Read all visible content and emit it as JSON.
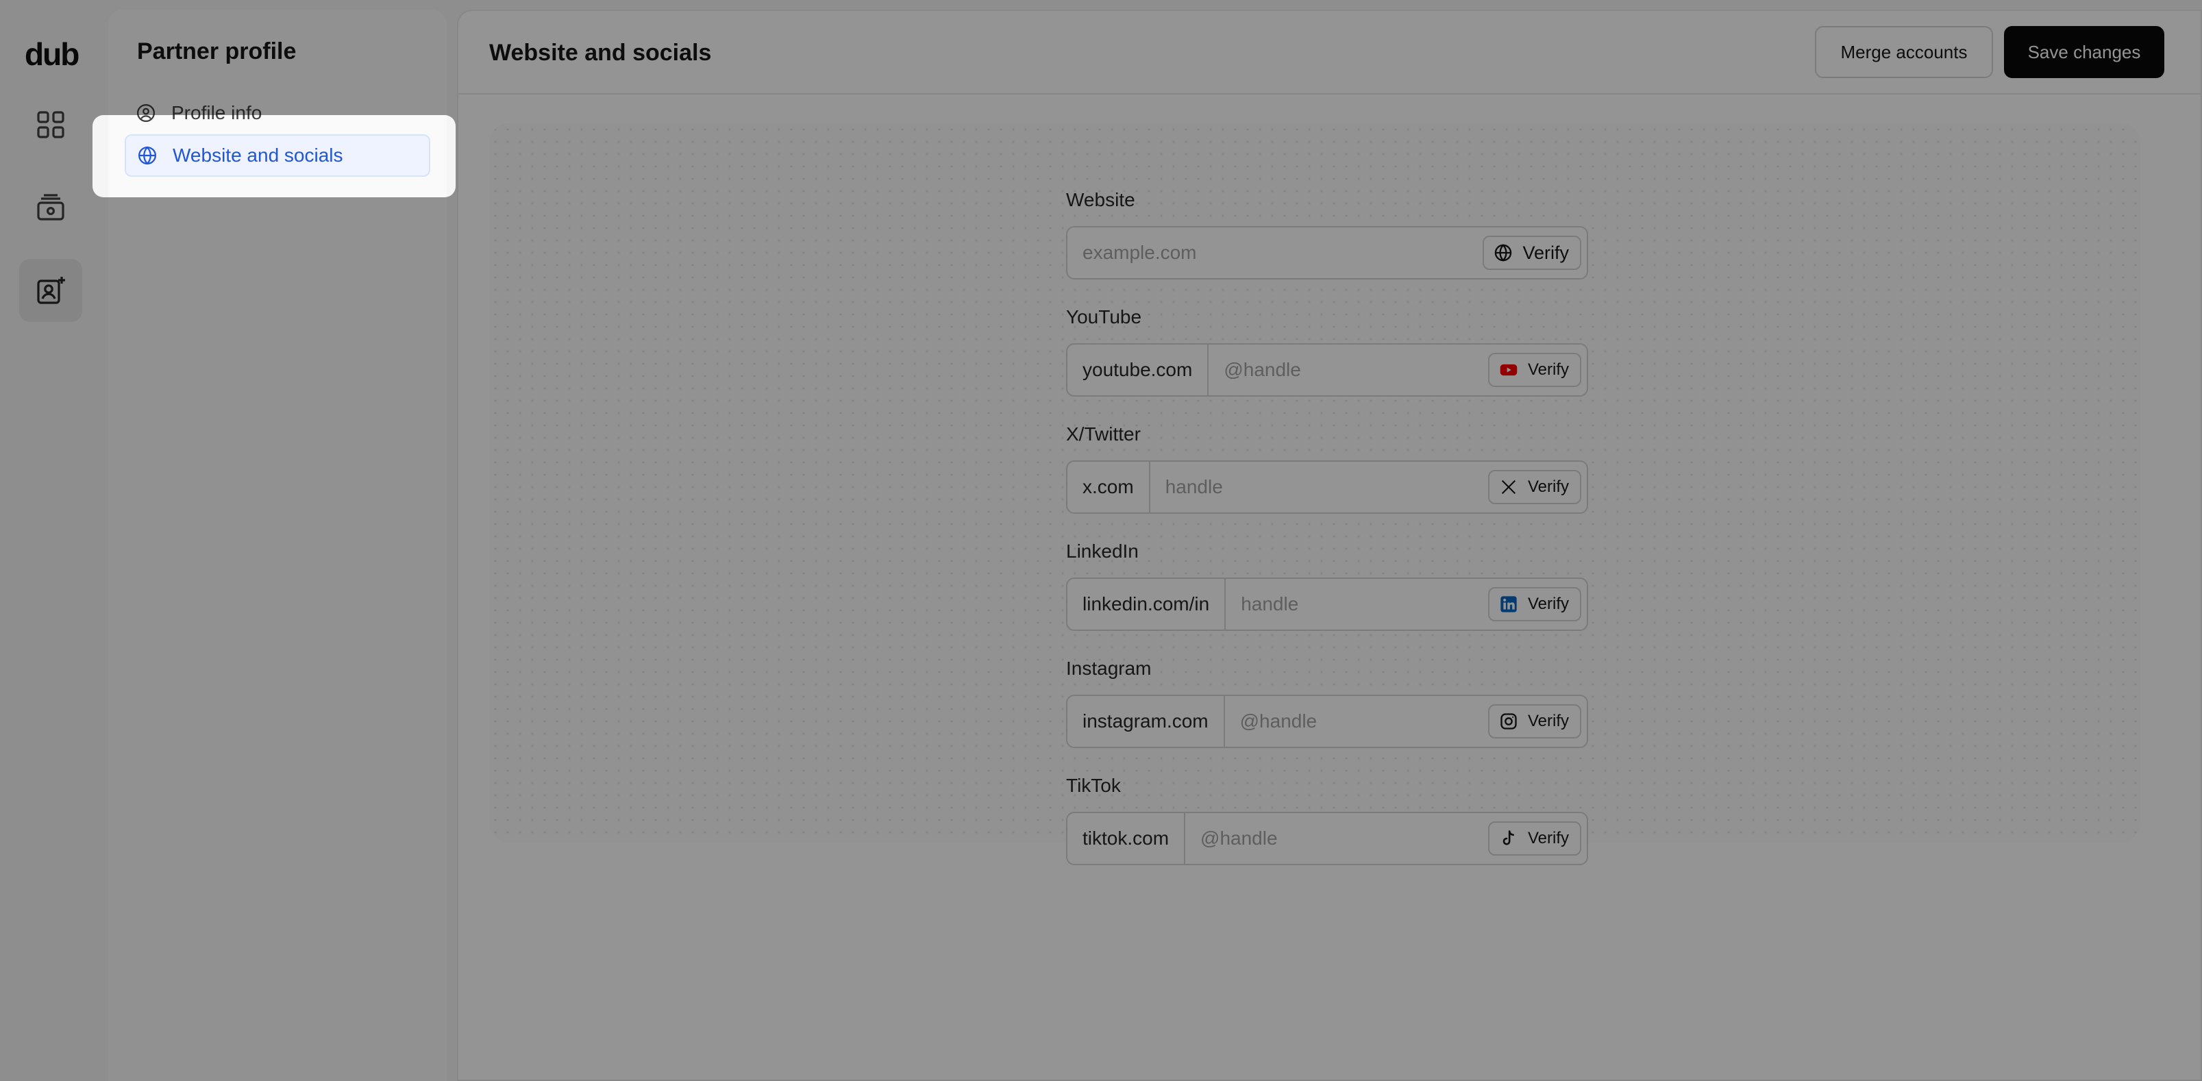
{
  "app": {
    "logo_text": "dub"
  },
  "rail": {
    "items": [
      {
        "icon": "grid-icon"
      },
      {
        "icon": "payouts-icon"
      },
      {
        "icon": "partner-profile-icon",
        "active": true
      }
    ]
  },
  "sidebar": {
    "title": "Partner profile",
    "items": [
      {
        "label": "Profile info",
        "icon": "user-circle-icon"
      },
      {
        "label": "Website and socials",
        "icon": "globe-icon",
        "selected": true
      }
    ]
  },
  "header": {
    "title": "Website and socials",
    "merge_label": "Merge accounts",
    "save_label": "Save changes"
  },
  "form": {
    "website": {
      "label": "Website",
      "placeholder": "example.com",
      "verify": "Verify"
    },
    "youtube": {
      "label": "YouTube",
      "prefix": "youtube.com",
      "placeholder": "@handle",
      "verify": "Verify"
    },
    "twitter": {
      "label": "X/Twitter",
      "prefix": "x.com",
      "placeholder": "handle",
      "verify": "Verify"
    },
    "linkedin": {
      "label": "LinkedIn",
      "prefix": "linkedin.com/in",
      "placeholder": "handle",
      "verify": "Verify"
    },
    "instagram": {
      "label": "Instagram",
      "prefix": "instagram.com",
      "placeholder": "@handle",
      "verify": "Verify"
    },
    "tiktok": {
      "label": "TikTok",
      "prefix": "tiktok.com",
      "placeholder": "@handle",
      "verify": "Verify"
    }
  },
  "colors": {
    "accent": "#2156d6",
    "youtube_red": "#ff0000",
    "linkedin_blue": "#0a66c2",
    "primary_button": "#0a0a0a"
  }
}
